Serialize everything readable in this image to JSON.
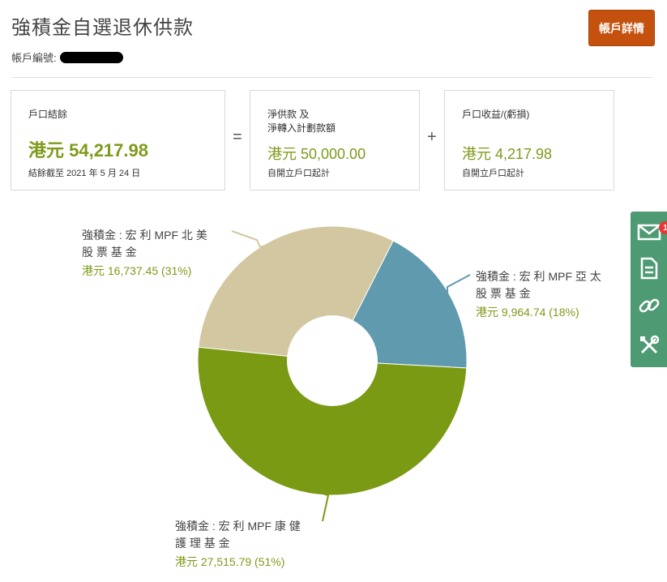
{
  "page": {
    "title": "強積金自選退休供款"
  },
  "account": {
    "label": "帳戶編號:"
  },
  "header": {
    "details_button": "帳戶詳情"
  },
  "summary": {
    "balance": {
      "label": "戶口結餘",
      "amount": "港元 54,217.98",
      "note": "結餘截至 2021 年 5 月 24 日"
    },
    "equals": "=",
    "contributions": {
      "label": "淨供款 及\n淨轉入計劃款額",
      "amount": "港元 50,000.00",
      "note": "自開立戶口起計"
    },
    "plus": "+",
    "gain": {
      "label": "戶口收益/(虧損)",
      "amount": "港元 4,217.98",
      "note": "自開立戶口起計"
    }
  },
  "chart_data": {
    "type": "pie",
    "labels": [
      "強積金 : 宏 利 MPF 亞 太 股 票 基 金",
      "強積金 : 宏 利 MPF 康 健 護 理 基 金",
      "強積金 : 宏 利 MPF 北 美 股 票 基 金"
    ],
    "values": [
      9964.74,
      27515.79,
      16737.45
    ],
    "percent": [
      18,
      51,
      31
    ],
    "colors": [
      "#5f9aae",
      "#7a9a14",
      "#d2c7a0"
    ],
    "text": [
      {
        "line1": "強積金 : 宏 利 MPF 亞 太",
        "line2": "股 票 基 金",
        "value": "港元 9,964.74 (18%)"
      },
      {
        "line1": "強積金 : 宏 利 MPF 康 健",
        "line2": "護 理 基 金",
        "value": "港元 27,515.79 (51%)"
      },
      {
        "line1": "強積金 : 宏 利 MPF 北 美",
        "line2": "股 票 基 金",
        "value": "港元 16,737.45 (31%)"
      }
    ]
  },
  "floating_toolbar": {
    "mail_badge": "1",
    "icons": [
      "mail-icon",
      "document-icon",
      "link-icon",
      "tools-icon"
    ],
    "color": "#4e9a73"
  }
}
